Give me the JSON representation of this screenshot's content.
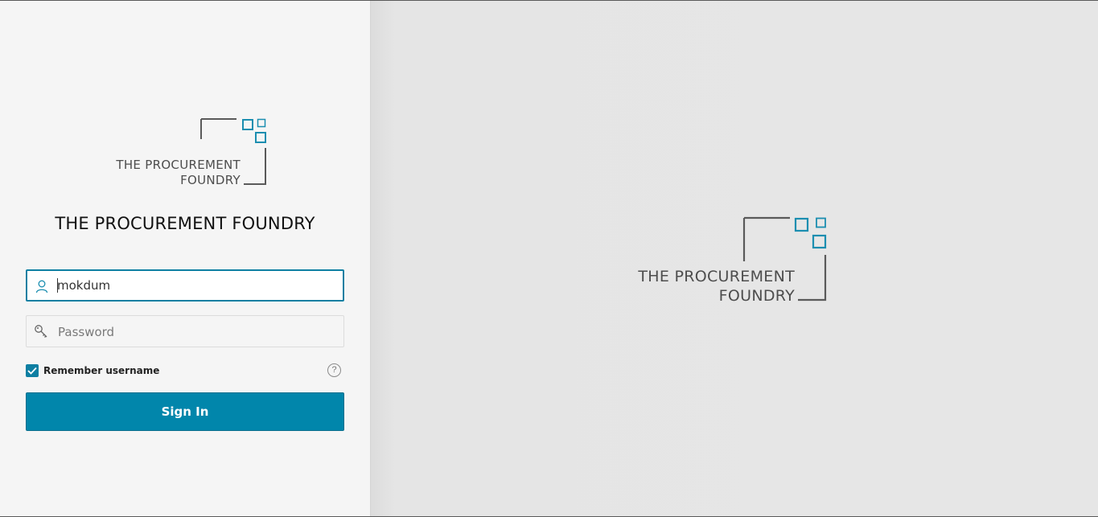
{
  "brand": {
    "logo_line1": "THE PROCUREMENT",
    "logo_line2": "FOUNDRY",
    "accent_color": "#0186ab",
    "logo_square_color": "#1b8eb0",
    "logo_frame_color": "#5a5a5a"
  },
  "login": {
    "title": "THE PROCUREMENT FOUNDRY",
    "username": {
      "value": "mokdum",
      "icon": "user-icon"
    },
    "password": {
      "placeholder": "Password",
      "icon": "key-icon"
    },
    "remember": {
      "label": "Remember username",
      "checked": true
    },
    "help_icon": "help-icon",
    "help_glyph": "?",
    "signin_label": "Sign In"
  }
}
